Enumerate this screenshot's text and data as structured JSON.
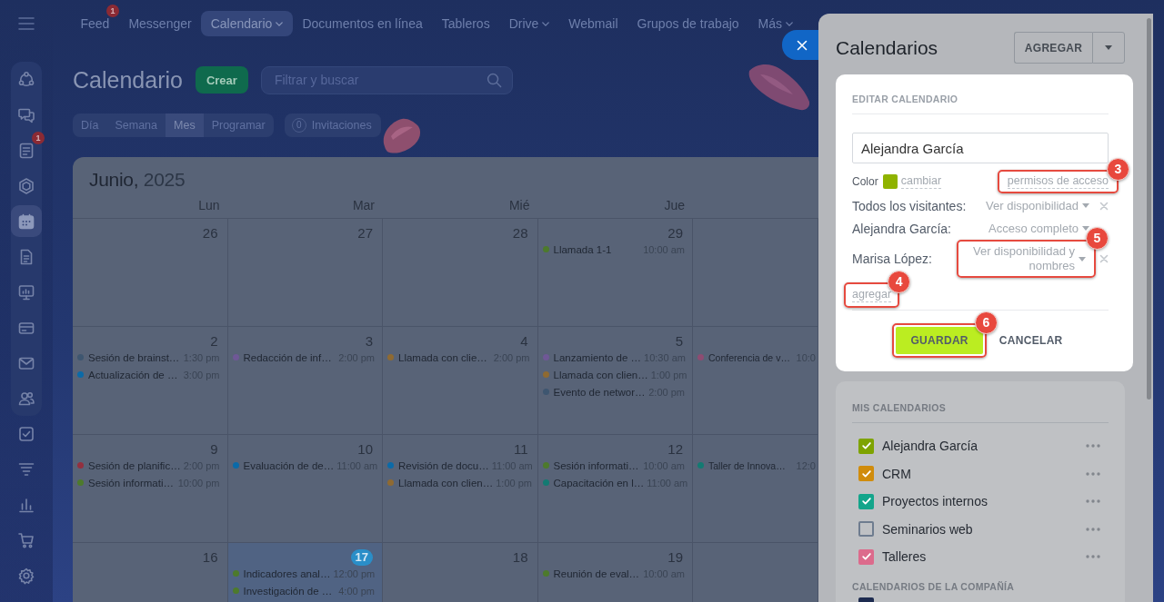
{
  "top_nav": {
    "items": [
      {
        "label": "Feed",
        "selected": false,
        "dropdown": false,
        "badge": "1"
      },
      {
        "label": "Messenger",
        "selected": false,
        "dropdown": false
      },
      {
        "label": "Calendario",
        "selected": true,
        "dropdown": true
      },
      {
        "label": "Documentos en línea",
        "selected": false,
        "dropdown": false
      },
      {
        "label": "Tableros",
        "selected": false,
        "dropdown": false
      },
      {
        "label": "Drive",
        "selected": false,
        "dropdown": true
      },
      {
        "label": "Webmail",
        "selected": false,
        "dropdown": false
      },
      {
        "label": "Grupos de trabajo",
        "selected": false,
        "dropdown": false
      },
      {
        "label": "Más",
        "selected": false,
        "dropdown": true
      }
    ]
  },
  "sidebar": {
    "groups": [
      {
        "items": [
          {
            "selected": false
          },
          {
            "selected": false
          },
          {
            "selected": false,
            "badge": "1"
          },
          {
            "selected": false
          },
          {
            "selected": true
          },
          {
            "selected": false
          },
          {
            "selected": false
          },
          {
            "selected": false
          },
          {
            "selected": false
          },
          {
            "selected": false
          }
        ]
      },
      {
        "items": [
          {
            "selected": false
          },
          {
            "selected": false
          },
          {
            "selected": false
          },
          {
            "selected": false
          },
          {
            "selected": false
          }
        ]
      }
    ]
  },
  "page": {
    "title": "Calendario",
    "create_button": "Crear",
    "search": {
      "placeholder": "Filtrar y buscar"
    },
    "view_tabs": [
      {
        "label": "Día",
        "selected": false
      },
      {
        "label": "Semana",
        "selected": false
      },
      {
        "label": "Mes",
        "selected": true
      },
      {
        "label": "Programar",
        "selected": false
      }
    ],
    "invitations": {
      "count": "0",
      "label": "Invitaciones"
    }
  },
  "calendar": {
    "month": "Junio,",
    "year": "2025",
    "weekdays": [
      "Lun",
      "Mar",
      "Mié",
      "Jue"
    ],
    "weeks": [
      {
        "days": [
          {
            "day": "26",
            "today": false
          },
          {
            "day": "27",
            "today": false
          },
          {
            "day": "28",
            "today": false
          },
          {
            "day": "29",
            "today": false,
            "events": [
              {
                "title": "Llamada 1-1",
                "time": "10:00 am",
                "color": "#4d7a2c"
              }
            ]
          },
          {
            "today": false
          }
        ]
      },
      {
        "days": [
          {
            "day": "2",
            "today": false,
            "events": [
              {
                "title": "Sesión de brainst…",
                "time": "1:30 pm",
                "color": "#3e5670"
              },
              {
                "title": "Actualización de …",
                "time": "3:00 pm",
                "color": "#0b6aa8"
              }
            ]
          },
          {
            "day": "3",
            "today": false,
            "events": [
              {
                "title": "Redacción de inf…",
                "time": "2:00 pm",
                "color": "#6f5896"
              }
            ]
          },
          {
            "day": "4",
            "today": false,
            "events": [
              {
                "title": "Llamada con clie…",
                "time": "2:00 pm",
                "color": "#8f6a32"
              }
            ]
          },
          {
            "day": "5",
            "today": false,
            "events": [
              {
                "title": "Lanzamiento de …",
                "time": "10:30 am",
                "color": "#6f5896"
              },
              {
                "title": "Llamada con clien…",
                "time": "1:00 pm",
                "color": "#8f6a32"
              },
              {
                "title": "Evento de networ…",
                "time": "2:00 pm",
                "color": "#3e5670"
              }
            ]
          },
          {
            "today": false,
            "events": [
              {
                "title": "Conferencia de v…",
                "time": "10:0",
                "color": "#8e4c72"
              }
            ]
          }
        ]
      },
      {
        "days": [
          {
            "day": "9",
            "today": false,
            "events": [
              {
                "title": "Sesión de planific…",
                "time": "2:00 pm",
                "color": "#93303f"
              },
              {
                "title": "Sesión informati…",
                "time": "10:00 pm",
                "color": "#4d7a2c"
              }
            ]
          },
          {
            "day": "10",
            "today": false,
            "events": [
              {
                "title": "Evaluación de de…",
                "time": "11:00 am",
                "color": "#0b6aa8"
              }
            ]
          },
          {
            "day": "11",
            "today": false,
            "events": [
              {
                "title": "Revisión de docu…",
                "time": "11:00 am",
                "color": "#0b6aa8"
              },
              {
                "title": "Llamada con clien…",
                "time": "1:00 pm",
                "color": "#8f6a32"
              }
            ]
          },
          {
            "day": "12",
            "today": false,
            "events": [
              {
                "title": "Sesión informati…",
                "time": "10:00 am",
                "color": "#4d7a2c"
              },
              {
                "title": "Capacitación en l…",
                "time": "11:00 am",
                "color": "#137a72"
              }
            ]
          },
          {
            "today": false,
            "events": [
              {
                "title": "Taller de Innova…",
                "time": "12:0",
                "color": "#137a72"
              }
            ]
          }
        ]
      },
      {
        "days": [
          {
            "day": "16",
            "today": false
          },
          {
            "day": "17",
            "today": true,
            "events": [
              {
                "title": "Indicadores anal…",
                "time": "12:00 pm",
                "color": "#4d7a2c"
              },
              {
                "title": "Investigación de …",
                "time": "4:00 pm",
                "color": "#4d7a2c"
              }
            ]
          },
          {
            "day": "18",
            "today": false
          },
          {
            "day": "19",
            "today": false,
            "events": [
              {
                "title": "Reunión de eval…",
                "time": "10:00 am",
                "color": "#4d7a2c"
              }
            ]
          },
          {
            "today": false
          }
        ]
      }
    ]
  },
  "panel": {
    "title": "Calendarios",
    "add_button": "AGREGAR",
    "edit_card": {
      "heading": "EDITAR CALENDARIO",
      "name_field": {
        "value": "Alejandra García"
      },
      "color_label": "Color",
      "color": "#8fb300",
      "change_link": "cambiar",
      "permissions_link": {
        "label": "permisos de acceso",
        "callout": "3"
      },
      "access": [
        {
          "label": "Todos los visitantes:",
          "value": "Ver disponibilidad",
          "removable": true
        },
        {
          "label": "Alejandra García:",
          "value": "Acceso completo",
          "removable": false
        },
        {
          "label": "Marisa López:",
          "value": "Ver disponibilidad y nombres",
          "removable": true,
          "callout": "5"
        }
      ],
      "add_link": {
        "label": "agregar",
        "callout": "4"
      },
      "save_button": {
        "label": "GUARDAR",
        "callout": "6"
      },
      "cancel_button": "CANCELAR"
    },
    "my_calendars": {
      "heading": "MIS CALENDARIOS",
      "items": [
        {
          "name": "Alejandra García",
          "color": "#7ea300",
          "checked": true
        },
        {
          "name": "CRM",
          "color": "#d08c0c",
          "checked": true
        },
        {
          "name": "Proyectos internos",
          "color": "#13a58b",
          "checked": true
        },
        {
          "name": "Seminarios web",
          "color": "#6e7c8f",
          "checked": false
        },
        {
          "name": "Talleres",
          "color": "#dc6b8c",
          "checked": true
        }
      ]
    },
    "company_calendars": {
      "heading": "CALENDARIOS DE LA COMPAÑÍA",
      "items": [
        {
          "color": "#1d2b50"
        }
      ]
    }
  }
}
